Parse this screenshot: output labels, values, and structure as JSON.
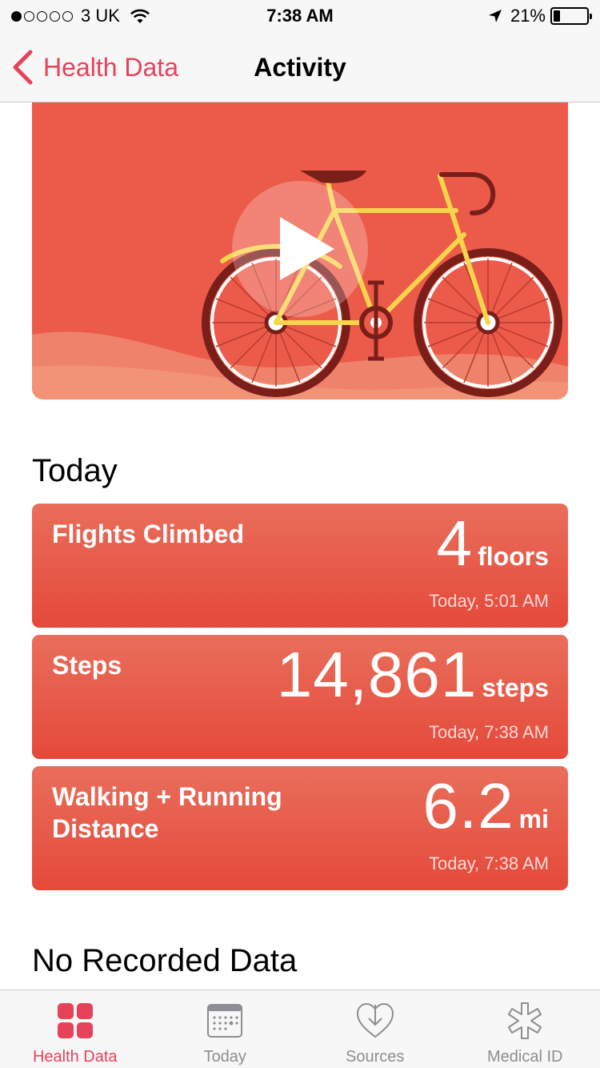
{
  "status_bar": {
    "carrier": "3 UK",
    "time": "7:38 AM",
    "battery_percent_label": "21%",
    "battery_level": 0.21,
    "signal_bars_filled": 1,
    "signal_bars_total": 5
  },
  "nav": {
    "back_label": "Health Data",
    "title": "Activity"
  },
  "hero": {
    "icon": "play-icon"
  },
  "sections": {
    "today": "Today",
    "no_data": "No Recorded Data"
  },
  "cards": [
    {
      "label": "Flights Climbed",
      "value": "4",
      "unit": "floors",
      "time": "Today, 5:01 AM"
    },
    {
      "label": "Steps",
      "value": "14,861",
      "unit": "steps",
      "time": "Today, 7:38 AM"
    },
    {
      "label": "Walking + Running Distance",
      "value": "6.2",
      "unit": "mi",
      "time": "Today, 7:38 AM"
    }
  ],
  "tabs": [
    {
      "label": "Health Data",
      "icon": "health-data-icon",
      "active": true
    },
    {
      "label": "Today",
      "icon": "calendar-icon",
      "active": false
    },
    {
      "label": "Sources",
      "icon": "sources-heart-icon",
      "active": false
    },
    {
      "label": "Medical ID",
      "icon": "medical-id-icon",
      "active": false
    }
  ],
  "colors": {
    "accent": "#e6425a",
    "card_top": "#e96e5b",
    "card_bottom": "#e5493a",
    "hero_bg": "#ec5b49",
    "tab_inactive": "#8e8e93"
  }
}
